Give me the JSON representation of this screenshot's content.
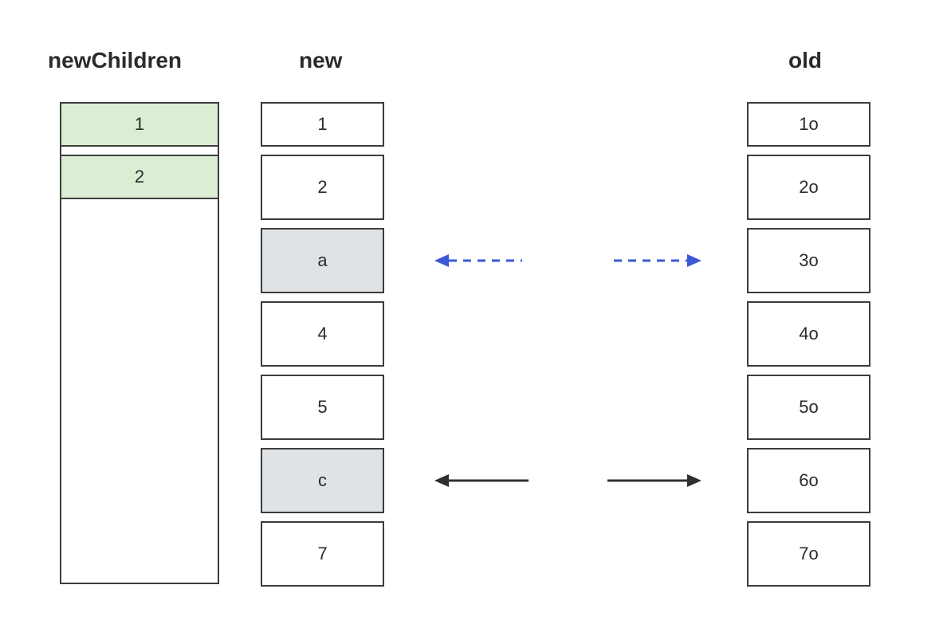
{
  "headings": {
    "newChildren": "newChildren",
    "new": "new",
    "old": "old"
  },
  "newChildren": {
    "items": [
      "1",
      "2"
    ]
  },
  "new": {
    "items": [
      "1",
      "2",
      "a",
      "4",
      "5",
      "c",
      "7"
    ]
  },
  "old": {
    "items": [
      "1o",
      "2o",
      "3o",
      "4o",
      "5o",
      "6o",
      "7o"
    ]
  },
  "arrows": {
    "top": {
      "style": "dashed",
      "color": "#3a59d6"
    },
    "bottom": {
      "style": "solid",
      "color": "#2f2f2f"
    }
  }
}
